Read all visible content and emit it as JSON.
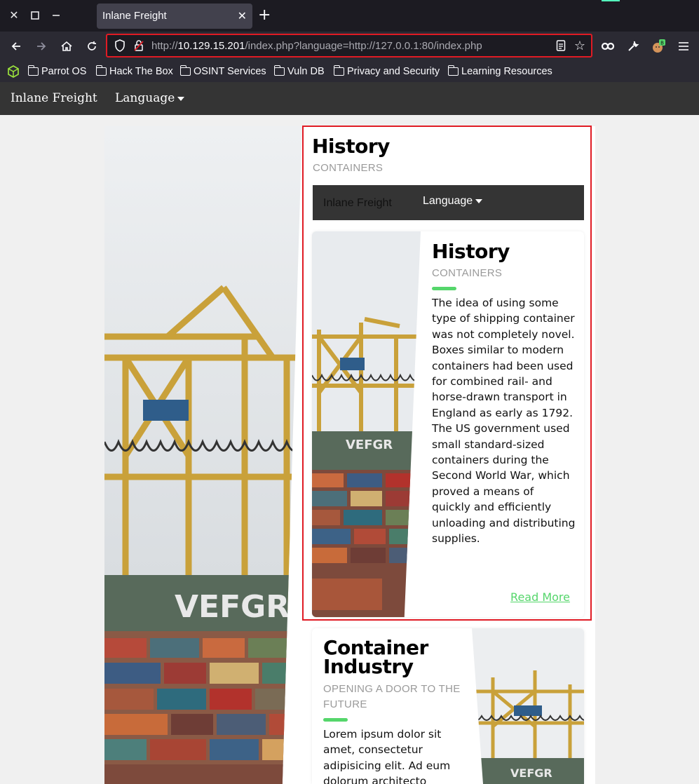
{
  "browser": {
    "tab_title": "Inlane Freight",
    "url_prefix": "http://",
    "url_host": "10.129.15.201",
    "url_path": "/index.php?language=http://127.0.0.1:80/index.php",
    "bookmarks": [
      "Parrot OS",
      "Hack The Box",
      "OSINT Services",
      "Vuln DB",
      "Privacy and Security",
      "Learning Resources"
    ]
  },
  "site": {
    "brand": "Inlane Freight",
    "language_label": "Language"
  },
  "included": {
    "title": "History",
    "subtitle": "CONTAINERS",
    "nav_brand": "Inlane Freight",
    "nav_language": "Language"
  },
  "card_history": {
    "title": "History",
    "subtitle": "CONTAINERS",
    "body": "The idea of using some type of shipping container was not completely novel. Boxes similar to modern containers had been used for combined rail- and horse-drawn transport in England as early as 1792. The US government used small standard-sized containers during the Second World War, which proved a means of quickly and efficiently unloading and distributing supplies.",
    "link": "Read More"
  },
  "card_industry": {
    "title_line1": "Container",
    "title_line2": "Industry",
    "subtitle": "OPENING A DOOR TO THE FUTURE",
    "body": "Lorem ipsum dolor sit amet, consectetur adipisicing elit. Ad eum dolorum architecto"
  },
  "colors": {
    "accent_green": "#55d66b",
    "highlight_red": "#e01b24",
    "nav_dark": "#343434"
  }
}
